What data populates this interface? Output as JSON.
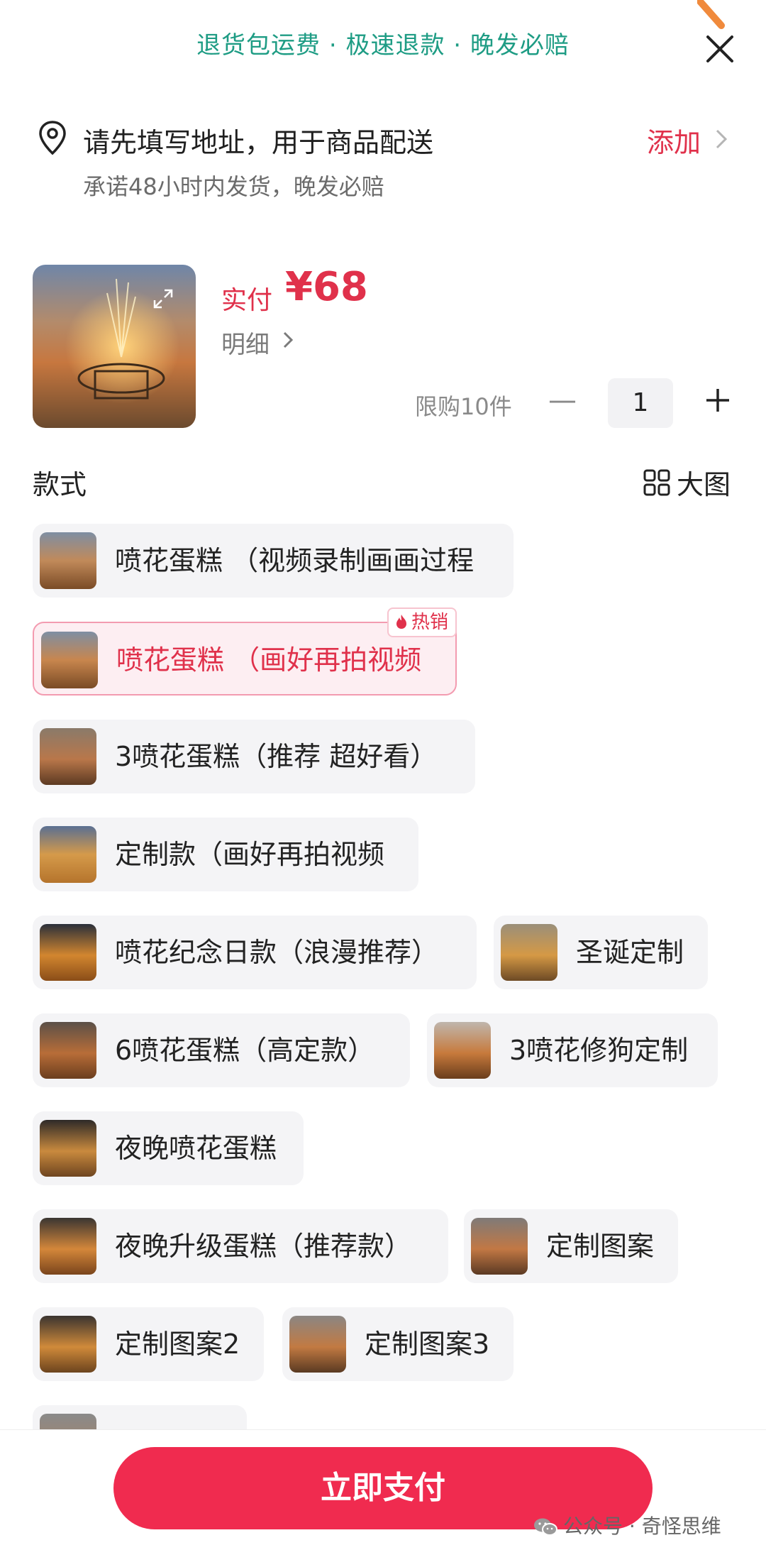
{
  "header": {
    "promise_text": "退货包运费 · 极速退款 · 晚发必赔",
    "close_icon": "close-icon"
  },
  "address": {
    "title": "请先填写地址，用于商品配送",
    "subtitle": "承诺48小时内发货，晚发必赔",
    "add_label": "添加"
  },
  "product": {
    "price_label": "实付",
    "price": "¥68",
    "detail_label": "明细",
    "limit_label": "限购10件",
    "quantity": "1"
  },
  "style_section": {
    "label": "款式",
    "big_view_label": "大图"
  },
  "options": [
    {
      "label": "喷花蛋糕 （视频录制画画过程"
    },
    {
      "label": "喷花蛋糕 （画好再拍视频",
      "selected": true,
      "badge": "热销"
    },
    {
      "label": "3喷花蛋糕（推荐 超好看）"
    },
    {
      "label": "定制款（画好再拍视频"
    },
    {
      "label": "喷花纪念日款（浪漫推荐）"
    },
    {
      "label": "圣诞定制"
    },
    {
      "label": "6喷花蛋糕（高定款）"
    },
    {
      "label": "3喷花修狗定制"
    },
    {
      "label": "夜晚喷花蛋糕"
    },
    {
      "label": "夜晚升级蛋糕（推荐款）"
    },
    {
      "label": "定制图案"
    },
    {
      "label": "定制图案2"
    },
    {
      "label": "定制图案3"
    }
  ],
  "footer": {
    "pay_label": "立即支付",
    "watermark": "公众号 · 奇怪思维"
  },
  "colors": {
    "accent": "#f02b4f",
    "price": "#e0314b",
    "promise": "#1e9c84"
  }
}
